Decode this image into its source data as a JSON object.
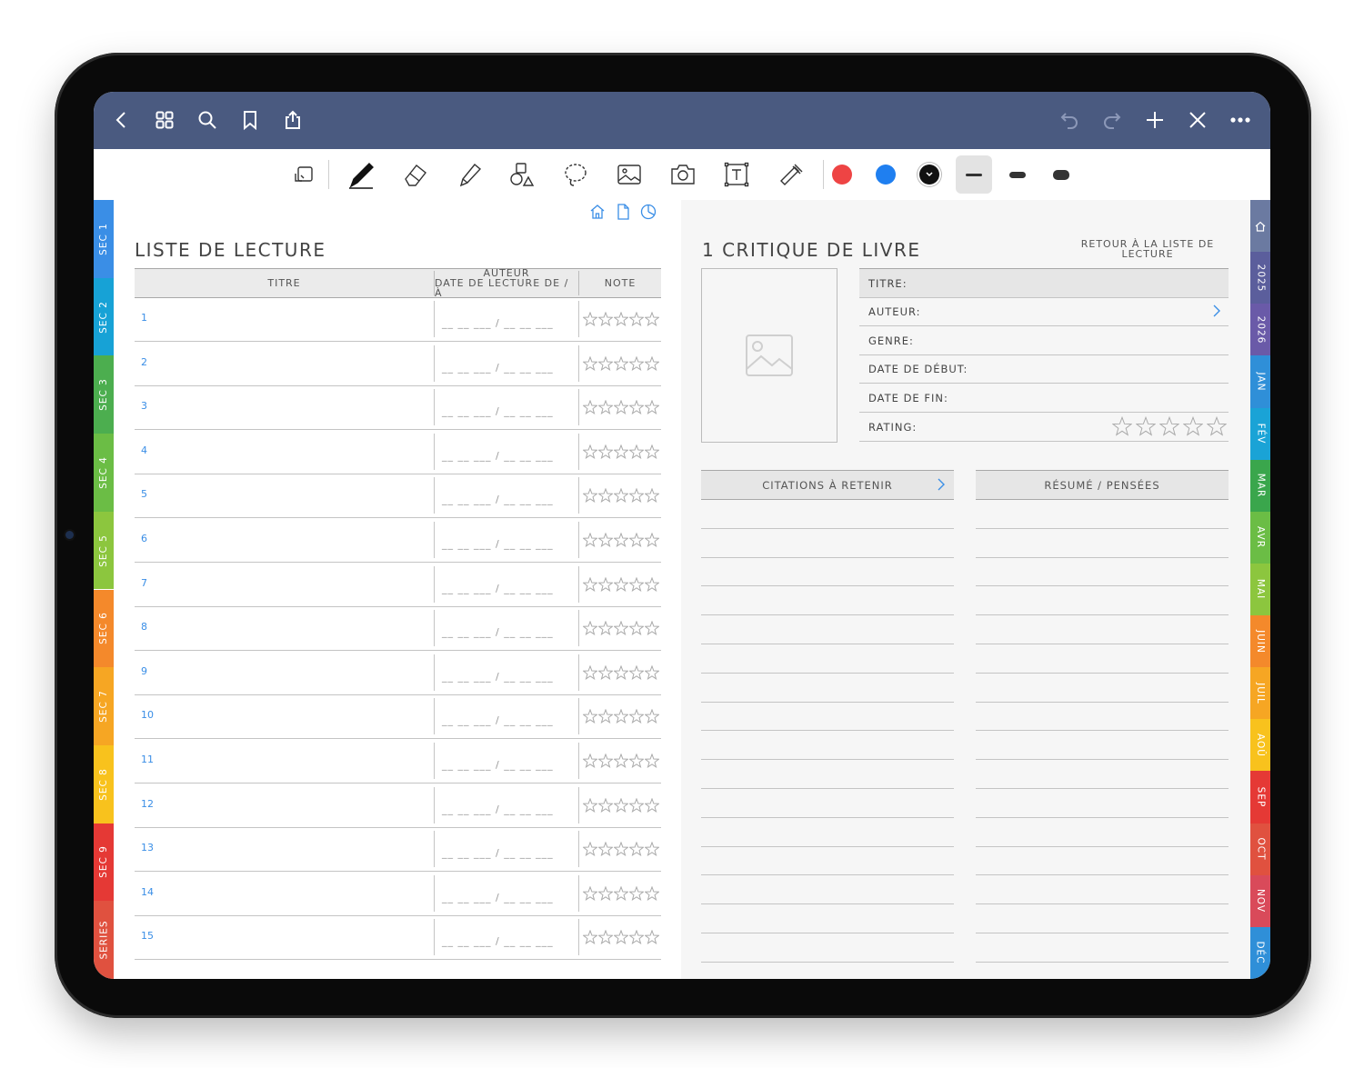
{
  "nav_icons": [
    "back-icon",
    "grid-icon",
    "search-icon",
    "bookmark-icon",
    "share-icon",
    "undo-icon",
    "redo-icon",
    "plus-icon",
    "close-icon",
    "more-icon"
  ],
  "tool_icons": [
    "read-only-icon",
    "pen-icon",
    "eraser-icon",
    "highlighter-icon",
    "shapes-icon",
    "lasso-icon",
    "image-icon",
    "camera-icon",
    "text-icon",
    "elements-icon"
  ],
  "colors": {
    "nav": "#4a5a80",
    "red": "#ee4444",
    "blue": "#1f7ff0",
    "black": "#111111",
    "accent": "#3a8ee6"
  },
  "left_tabs": [
    {
      "label": "SEC 1",
      "color": "#3a8ee6"
    },
    {
      "label": "SEC 2",
      "color": "#17a2d6"
    },
    {
      "label": "SEC 3",
      "color": "#4cae4f"
    },
    {
      "label": "SEC 4",
      "color": "#6bbd45"
    },
    {
      "label": "SEC 5",
      "color": "#8cc63e"
    },
    {
      "label": "SEC 6",
      "color": "#f4892b"
    },
    {
      "label": "SEC 7",
      "color": "#f6a623"
    },
    {
      "label": "SEC 8",
      "color": "#f8c21d"
    },
    {
      "label": "SEC 9",
      "color": "#e53935"
    },
    {
      "label": "SERIES",
      "color": "#e0513f"
    }
  ],
  "right_tabs": [
    {
      "label": "",
      "color": "#6b7aa1"
    },
    {
      "label": "2025",
      "color": "#5b5e9c"
    },
    {
      "label": "2026",
      "color": "#6a5aa8"
    },
    {
      "label": "JAN",
      "color": "#2f8fd8"
    },
    {
      "label": "FÉV",
      "color": "#1aa3d6"
    },
    {
      "label": "MAR",
      "color": "#3aa64c"
    },
    {
      "label": "AVR",
      "color": "#6bbd45"
    },
    {
      "label": "MAI",
      "color": "#8cc63e"
    },
    {
      "label": "JUIN",
      "color": "#f4892b"
    },
    {
      "label": "JUIL",
      "color": "#f6a623"
    },
    {
      "label": "AOÛ",
      "color": "#f8c21d"
    },
    {
      "label": "SEP",
      "color": "#e53935"
    },
    {
      "label": "OCT",
      "color": "#e0513f"
    },
    {
      "label": "NOV",
      "color": "#d94a5a"
    },
    {
      "label": "DÉC",
      "color": "#2f8fd8"
    }
  ],
  "left_page": {
    "title": "LISTE DE LECTURE",
    "col_title": "TITRE",
    "col_author": "AUTEUR",
    "col_dates": "DATE DE LECTURE DE / À",
    "col_rating": "NOTE",
    "date_placeholder": "__ __ ___  /  __ __ ___",
    "rows": [
      "1",
      "2",
      "3",
      "4",
      "5",
      "6",
      "7",
      "8",
      "9",
      "10",
      "11",
      "12",
      "13",
      "14",
      "15"
    ]
  },
  "right_page": {
    "title": "1 CRITIQUE DE LIVRE",
    "back_link": "RETOUR À LA LISTE DE LECTURE",
    "fields": [
      "TITRE:",
      "AUTEUR:",
      "GENRE:",
      "DATE DE DÉBUT:",
      "DATE DE FIN:",
      "RATING:"
    ],
    "quotes_header": "CITATIONS À RETENIR",
    "summary_header": "RÉSUMÉ / PENSÉES"
  }
}
